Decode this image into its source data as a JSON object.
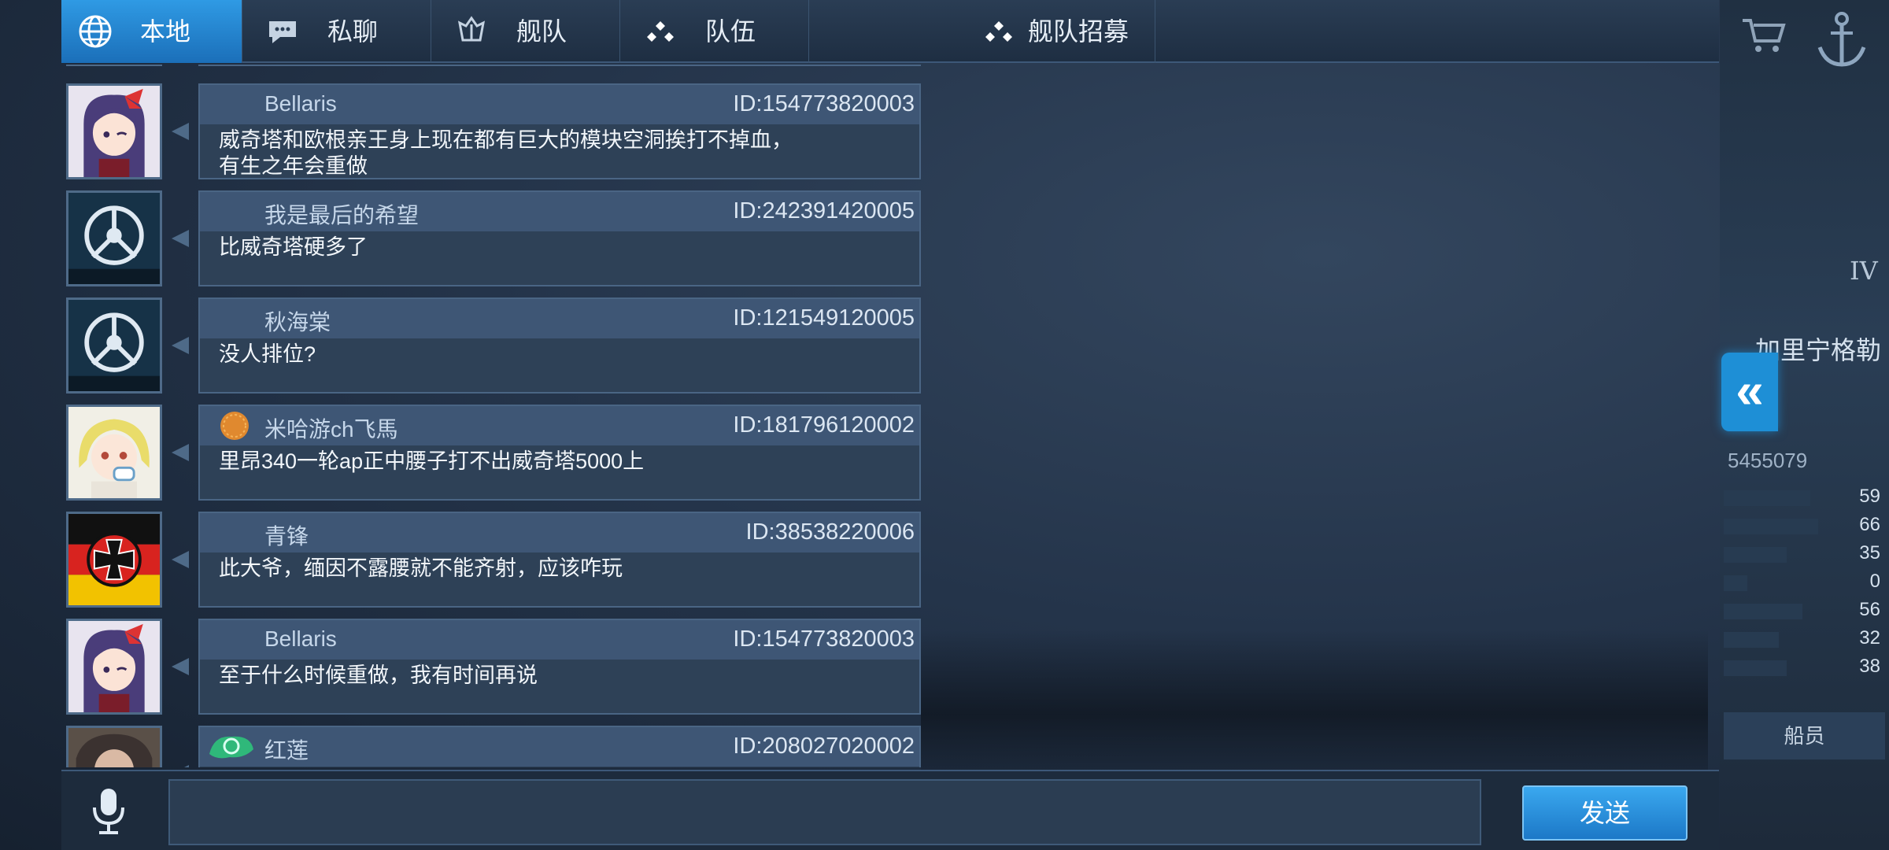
{
  "tabs": [
    {
      "label": "本地",
      "icon": "globe-icon",
      "active": true
    },
    {
      "label": "私聊",
      "icon": "chat-bubble-icon",
      "active": false
    },
    {
      "label": "舰队",
      "icon": "fleet-emblem-icon",
      "active": false
    },
    {
      "label": "队伍",
      "icon": "team-dots-icon",
      "active": false
    },
    {
      "label": "舰队招募",
      "icon": "team-dots-icon",
      "active": false
    }
  ],
  "messages": [
    {
      "name": "Bellaris",
      "id": "ID:154773820003",
      "text": "威奇塔和欧根亲王身上现在都有巨大的模块空洞挨打不掉血，有生之年会重做",
      "avatar": "anime-girl-red-bow"
    },
    {
      "name": "我是最后的希望",
      "id": "ID:242391420005",
      "text": "比威奇塔硬多了",
      "avatar": "crosshair-emblem"
    },
    {
      "name": "秋海棠",
      "id": "ID:121549120005",
      "text": "没人排位?",
      "avatar": "crosshair-emblem"
    },
    {
      "name": "米哈游ch飞馬",
      "id": "ID:181796120002",
      "text": "里昂340一轮ap正中腰子打不出威奇塔5000上",
      "avatar": "anime-girl-blonde",
      "badge": "cookie-badge"
    },
    {
      "name": "青锋",
      "id": "ID:38538220006",
      "text": "此大爷，缅因不露腰就不能齐射，应该咋玩",
      "avatar": "german-flag-iron-cross"
    },
    {
      "name": "Bellaris",
      "id": "ID:154773820003",
      "text": "至于什么时候重做，我有时间再说",
      "avatar": "anime-girl-red-bow"
    },
    {
      "name": "红莲",
      "id": "ID:208027020002",
      "text": "",
      "avatar": "anime-girl-dark",
      "badge": "green-dragon-badge"
    }
  ],
  "bottom": {
    "input_value": "",
    "send_label": "发送",
    "mic_icon": "microphone-icon"
  },
  "side": {
    "tier": "IV",
    "ship_name": "加里宁格勒",
    "player_id": "5455079",
    "stats": [
      "59",
      "66",
      "35",
      "0",
      "56",
      "32",
      "38"
    ],
    "crew_label": "船员",
    "expand_icon": "double-chevron-left-icon"
  },
  "colors": {
    "accent": "#1e8fd6",
    "panel": "#2e4157",
    "header": "#3e5675"
  }
}
